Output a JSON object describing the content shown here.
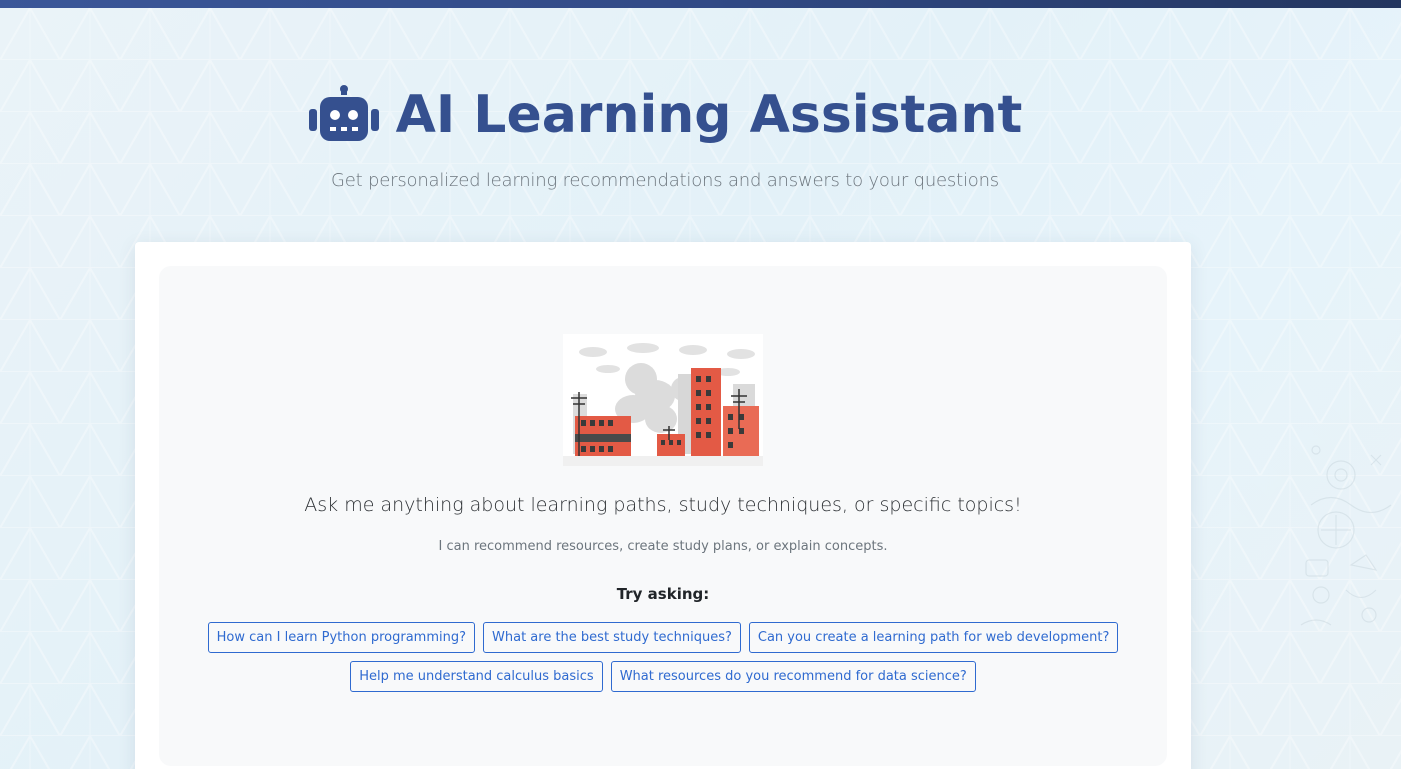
{
  "header": {
    "title": "AI Learning Assistant",
    "subtitle": "Get personalized learning recommendations and answers to your questions",
    "icon": "robot-icon"
  },
  "colors": {
    "accent": "#35508f",
    "top_bar": "#2c4274",
    "button_border": "#2f6ad0",
    "card_background": "#ffffff",
    "panel_background": "#f8f9fa"
  },
  "welcome": {
    "heading": "Ask me anything about learning paths, study techniques, or specific topics!",
    "hint": "I can recommend resources, create study plans, or explain concepts.",
    "illustration": "ruined-city-illustration"
  },
  "suggestions": {
    "label": "Try asking:",
    "items": [
      "How can I learn Python programming?",
      "What are the best study techniques?",
      "Can you create a learning path for web development?",
      "Help me understand calculus basics",
      "What resources do you recommend for data science?"
    ]
  }
}
